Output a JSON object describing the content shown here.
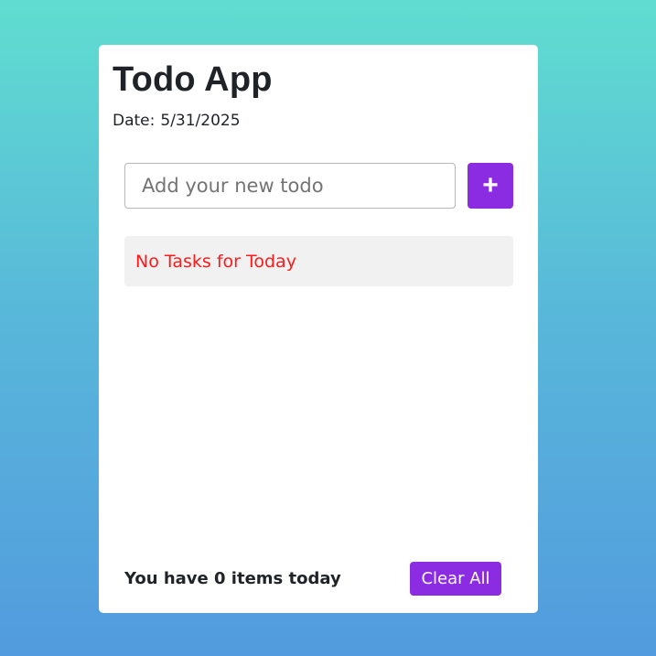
{
  "app": {
    "title": "Todo App",
    "date_label": "Date:",
    "date_value": "5/31/2025"
  },
  "input": {
    "placeholder": "Add your new todo",
    "value": ""
  },
  "add_button": {
    "label": "+"
  },
  "tasks": {
    "empty_message": "No Tasks for Today",
    "items": []
  },
  "footer": {
    "count_text": "You have 0 items today",
    "clear_label": "Clear All"
  },
  "colors": {
    "accent": "#8b2be2",
    "empty_text": "#ff1a1a",
    "gradient_top": "#60ddd0",
    "gradient_bottom": "#529bde"
  }
}
